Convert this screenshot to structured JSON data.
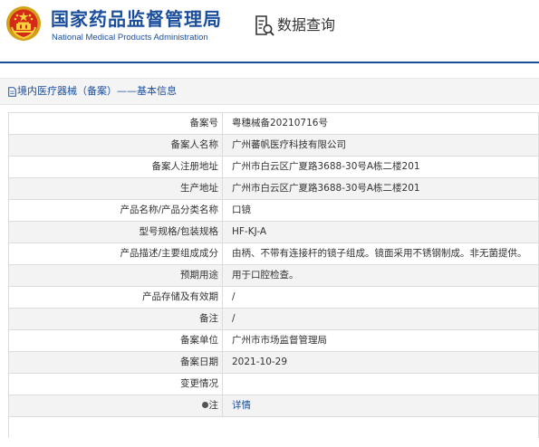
{
  "header": {
    "org_name_cn": "国家药品监督管理局",
    "org_name_en": "National Medical Products Administration",
    "query_title": "数据查询",
    "emblem_icon": "national-emblem-icon",
    "query_icon": "document-search-icon",
    "brand_color": "#1a4e9c"
  },
  "breadcrumb": {
    "text": "境内医疗器械（备案）——基本信息",
    "icon": "document-icon"
  },
  "record": {
    "rows": [
      {
        "label": "备案号",
        "value": "粤穗械备20210716号"
      },
      {
        "label": "备案人名称",
        "value": "广州蕃帆医疗科技有限公司"
      },
      {
        "label": "备案人注册地址",
        "value": "广州市白云区广夏路3688-30号A栋二楼201"
      },
      {
        "label": "生产地址",
        "value": "广州市白云区广夏路3688-30号A栋二楼201"
      },
      {
        "label": "产品名称/产品分类名称",
        "value": "口镜"
      },
      {
        "label": "型号规格/包装规格",
        "value": "HF-KJ-A"
      },
      {
        "label": "产品描述/主要组成成分",
        "value": "由柄、不带有连接杆的镜子组成。镜面采用不锈钢制成。非无菌提供。"
      },
      {
        "label": "预期用途",
        "value": "用于口腔检查。"
      },
      {
        "label": "产品存储及有效期",
        "value": "/"
      },
      {
        "label": "备注",
        "value": "/"
      },
      {
        "label": "备案单位",
        "value": "广州市市场监督管理局"
      },
      {
        "label": "备案日期",
        "value": "2021-10-29"
      },
      {
        "label": "变更情况",
        "value": ""
      },
      {
        "label": "注",
        "value": "详情"
      }
    ]
  }
}
